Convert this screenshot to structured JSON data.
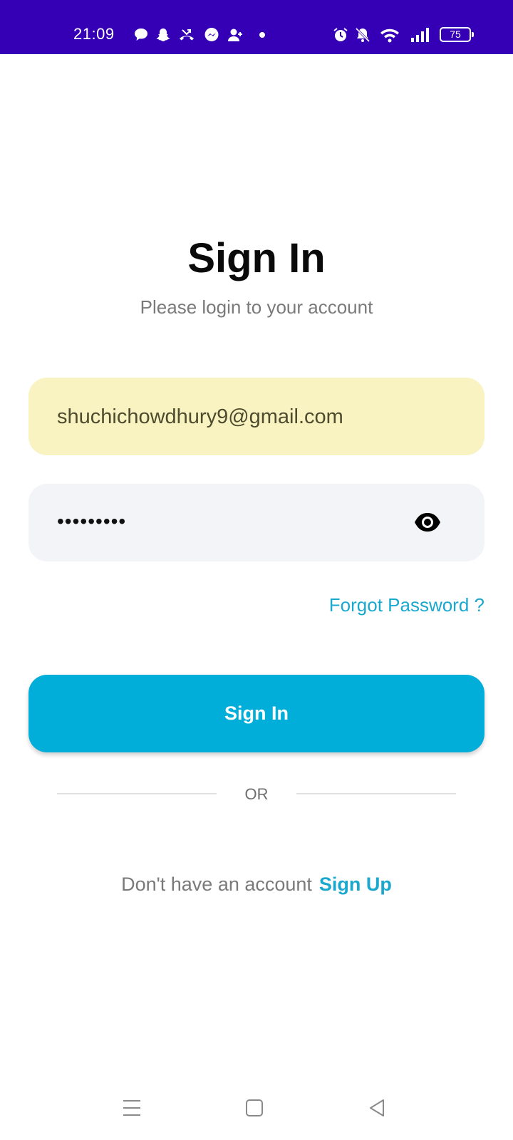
{
  "status_bar": {
    "time": "21:09",
    "background_color": "#3500b5",
    "notification_icons": [
      "chat-bubble-icon",
      "snapchat-icon",
      "missed-call-icon",
      "messenger-icon",
      "add-person-icon",
      "dot-icon"
    ],
    "system_icons": [
      "alarm-icon",
      "mute-icon",
      "wifi-icon",
      "signal-icon"
    ],
    "battery_level": "75"
  },
  "header": {
    "title": "Sign In",
    "subtitle": "Please login to your account"
  },
  "form": {
    "email_value": "shuchichowdhury9@gmail.com",
    "email_field_color": "#f8f3c1",
    "password_value": "•••••••••",
    "password_field_color": "#f3f4f7",
    "visibility_icon": "eye-icon",
    "forgot_password_label": "Forgot Password ?",
    "submit_label": "Sign In",
    "divider_label": "OR"
  },
  "footer": {
    "prompt": "Don't have an account",
    "signup_label": "Sign Up"
  },
  "navigation_bar": [
    "menu-icon",
    "home-icon",
    "back-icon"
  ],
  "colors": {
    "accent": "#00aed9",
    "link": "#1aa8cf",
    "text_primary": "#0a0a0a",
    "text_secondary": "#7a7a7a"
  }
}
